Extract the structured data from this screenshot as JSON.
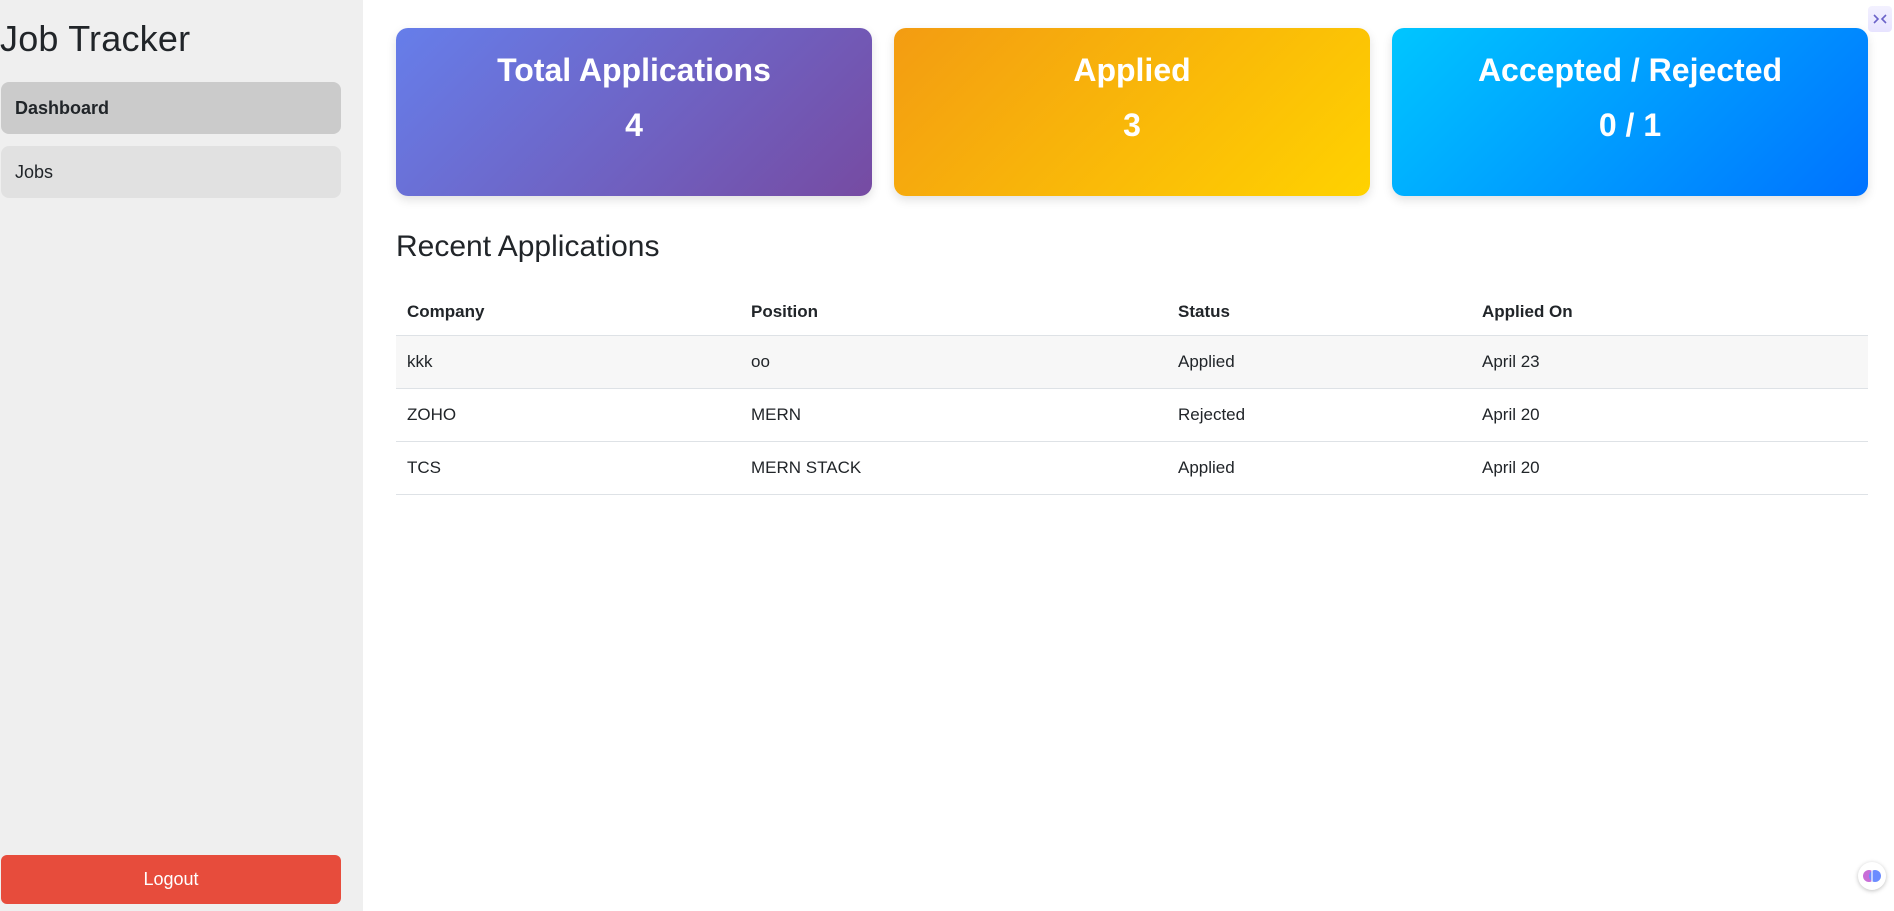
{
  "sidebar": {
    "title": "Job Tracker",
    "items": [
      {
        "label": "Dashboard"
      },
      {
        "label": "Jobs"
      }
    ],
    "logout_label": "Logout"
  },
  "stats": [
    {
      "title": "Total Applications",
      "value": "4"
    },
    {
      "title": "Applied",
      "value": "3"
    },
    {
      "title": "Accepted / Rejected",
      "value": "0 / 1"
    }
  ],
  "recent": {
    "title": "Recent Applications",
    "columns": [
      "Company",
      "Position",
      "Status",
      "Applied On"
    ],
    "rows": [
      {
        "company": "kkk",
        "position": "oo",
        "status": "Applied",
        "applied_on": "April 23"
      },
      {
        "company": "ZOHO",
        "position": "MERN",
        "status": "Rejected",
        "applied_on": "April 20"
      },
      {
        "company": "TCS",
        "position": "MERN STACK",
        "status": "Applied",
        "applied_on": "April 20"
      }
    ]
  },
  "colors": {
    "sidebar_bg": "#efefef",
    "active_nav": "#cbcbcb",
    "logout": "#e74c3c",
    "card_total": [
      "#667eea",
      "#764ba2"
    ],
    "card_applied": [
      "#f39c12",
      "#ffd200"
    ],
    "card_accepted": [
      "#00c6ff",
      "#0072ff"
    ]
  },
  "icons": {
    "top_right": "extension-icon",
    "bottom_right": "brain-icon"
  }
}
